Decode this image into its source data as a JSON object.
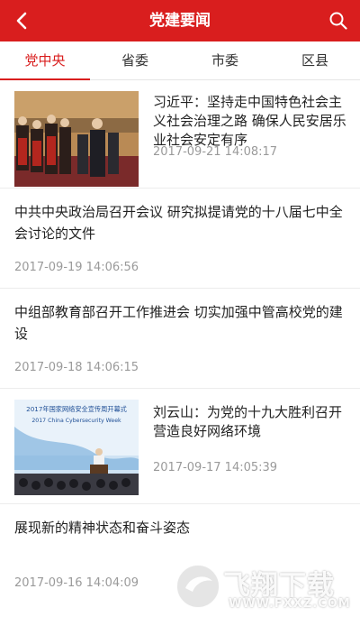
{
  "header": {
    "title": "党建要闻",
    "back_icon": "chevron-left-icon",
    "search_icon": "search-icon",
    "bg_color": "#d91e1e"
  },
  "tabs": [
    {
      "label": "党中央",
      "active": true
    },
    {
      "label": "省委",
      "active": false
    },
    {
      "label": "市委",
      "active": false
    },
    {
      "label": "区县",
      "active": false
    }
  ],
  "accent_color": "#d91e1e",
  "news": [
    {
      "title": "习近平：坚持走中国特色社会主义社会治理之路 确保人民安居乐业社会安定有序",
      "time": "2017-09-21 14:08:17",
      "has_image": true
    },
    {
      "title": "中共中央政治局召开会议 研究拟提请党的十八届七中全会讨论的文件",
      "time": "2017-09-19 14:06:56",
      "has_image": false
    },
    {
      "title": "中组部教育部召开工作推进会 切实加强中管高校党的建设",
      "time": "2017-09-18 14:06:15",
      "has_image": false
    },
    {
      "title": "刘云山：为党的十九大胜利召开营造良好网络环境",
      "time": "2017-09-17 14:05:39",
      "has_image": true
    },
    {
      "title": "展现新的精神状态和奋斗姿态",
      "time": "2017-09-16 14:04:09",
      "has_image": false
    }
  ],
  "photo2": {
    "banner_line1": "2017年国家网络安全宣传周开幕式",
    "banner_line2": "2017 China Cybersecurity Week"
  },
  "watermark": {
    "text": "飞翔下载",
    "url": "WWW.FXXZ.COM"
  }
}
